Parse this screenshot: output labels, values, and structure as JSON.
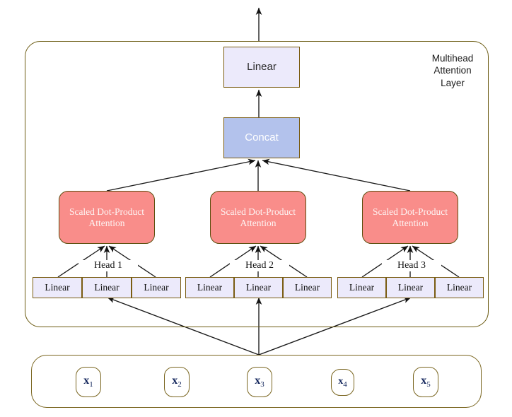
{
  "diagram": {
    "title": "Multihead Attention Layer",
    "layer_caption": "Multihead\nAttention\nLayer",
    "output_projection": {
      "label": "Linear"
    },
    "concat": {
      "label": "Concat"
    },
    "attention_blocks": [
      {
        "label": "Scaled Dot-Product\nAttention",
        "line1": "Scaled Dot-Product",
        "line2": "Attention"
      },
      {
        "label": "Scaled Dot-Product\nAttention",
        "line1": "Scaled Dot-Product",
        "line2": "Attention"
      },
      {
        "label": "Scaled Dot-Product\nAttention",
        "line1": "Scaled Dot-Product",
        "line2": "Attention"
      }
    ],
    "heads": [
      {
        "label": "Head 1",
        "projections": [
          {
            "label": "Linear"
          },
          {
            "label": "Linear"
          },
          {
            "label": "Linear"
          }
        ]
      },
      {
        "label": "Head 2",
        "projections": [
          {
            "label": "Linear"
          },
          {
            "label": "Linear"
          },
          {
            "label": "Linear"
          }
        ]
      },
      {
        "label": "Head 3",
        "projections": [
          {
            "label": "Linear"
          },
          {
            "label": "Linear"
          },
          {
            "label": "Linear"
          }
        ]
      }
    ],
    "inputs": [
      {
        "symbol": "x",
        "subscript": "1"
      },
      {
        "symbol": "x",
        "subscript": "2"
      },
      {
        "symbol": "x",
        "subscript": "3"
      },
      {
        "symbol": "x",
        "subscript": "4"
      },
      {
        "symbol": "x",
        "subscript": "5"
      }
    ],
    "colors": {
      "attention_fill": "#f98d8a",
      "concat_fill": "#b3c2ec",
      "linear_fill": "#eceafb",
      "border_gold": "#7a5c12",
      "container_border": "#6b5b12",
      "arrow": "#1a1a1a",
      "token_text": "#13265c"
    }
  }
}
